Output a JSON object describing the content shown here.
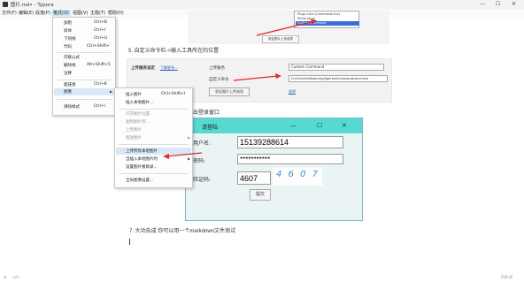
{
  "window": {
    "title": "图片.md• - Typora",
    "minimize": "—",
    "maximize": "☐",
    "close": "✕"
  },
  "menubar": [
    {
      "label": "文件(F)"
    },
    {
      "label": "编辑(E)"
    },
    {
      "label": "段落(P)"
    },
    {
      "label": "格式(O)"
    },
    {
      "label": "视图(V)"
    },
    {
      "label": "主题(T)"
    },
    {
      "label": "帮助(H)"
    }
  ],
  "format_menu": {
    "items": [
      {
        "label": "加粗",
        "shortcut": "Ctrl+B"
      },
      {
        "label": "斜体",
        "shortcut": "Ctrl+I"
      },
      {
        "label": "下划线",
        "shortcut": "Ctrl+U"
      },
      {
        "label": "代码",
        "shortcut": "Ctrl+Shift+`"
      },
      {
        "label": "内联公式",
        "shortcut": ""
      },
      {
        "label": "删除线",
        "shortcut": "Alt+Shift+5"
      },
      {
        "label": "注释",
        "shortcut": ""
      },
      {
        "label": "超链接",
        "shortcut": "Ctrl+K"
      },
      {
        "label": "图像",
        "shortcut": ""
      },
      {
        "label": "清除样式",
        "shortcut": "Ctrl+\\"
      }
    ]
  },
  "image_submenu": {
    "items": [
      {
        "label": "插入图片",
        "shortcut": "Ctrl+Shift+I"
      },
      {
        "label": "插入本地图片...",
        "shortcut": ""
      },
      {
        "label": "打开图片位置...",
        "shortcut": ""
      },
      {
        "label": "复制图片到...",
        "shortcut": ""
      },
      {
        "label": "上传图片",
        "shortcut": ""
      },
      {
        "label": "缩放图片",
        "shortcut": ""
      },
      {
        "label": "上传所有本地图片",
        "shortcut": ""
      },
      {
        "label": "当插入本地图片时",
        "shortcut": ""
      },
      {
        "label": "设置图片根目录...",
        "shortcut": ""
      },
      {
        "label": "全局图像设置...",
        "shortcut": ""
      }
    ]
  },
  "doc": {
    "shot1": {
      "popup_items": [
        "Picgo-Core (Command line)",
        "PicGo (app)",
        "Custom Command"
      ],
      "button": "验证图片上传选项"
    },
    "step5": "5. 自定义命令栏->输入工具所在的位置",
    "settings": {
      "service_label": "上传服务设定",
      "service_link": "了解更多...",
      "uploader_label": "上传服务",
      "uploader_value": "Custom Command",
      "command_label": "自定义命令",
      "command_value": "D:\\GreenSoftware\\pyfigerbed\\chaowngcolud.exe",
      "verify_button": "验证图片上传选项",
      "help_link": "说明"
    },
    "step6_suffix": "弹出登录窗口",
    "login": {
      "title": "请登陆",
      "user_label": "用户名:",
      "user_value": "15139288614",
      "pwd_label": "密码:",
      "pwd_value": "***********",
      "code_label": "验证码:",
      "code_value": "4607",
      "captcha": "4 6 0 7",
      "submit": "提交",
      "wc_min": "—",
      "wc_max": "☐",
      "wc_close": "✕"
    },
    "step7": "7. 大功告成 你可以用一个markdown文件测试"
  },
  "status": {
    "left_icon": "⊘",
    "nav": "</>",
    "word_count": "216 词"
  },
  "colors": {
    "accent": "#55d9d0",
    "arrow": "#e8252a",
    "selection": "#3a6fd8",
    "link": "#2a63b8"
  }
}
